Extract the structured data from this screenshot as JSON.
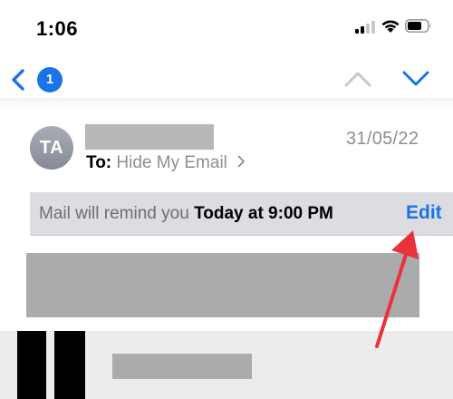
{
  "status_bar": {
    "time": "1:06",
    "icons": [
      "cellular-signal-icon",
      "wifi-icon",
      "battery-icon"
    ]
  },
  "nav": {
    "unread_count": "1",
    "icons": [
      "back-chevron-icon",
      "previous-message-chevron-icon",
      "next-message-chevron-icon"
    ]
  },
  "message": {
    "avatar_initials": "TA",
    "date": "31/05/22",
    "to_label": "To:",
    "to_value": "Hide My Email"
  },
  "reminder": {
    "text": "Mail will remind you",
    "time": "Today at 9:00 PM",
    "edit_label": "Edit"
  },
  "colors": {
    "accent": "#1a73e8",
    "banner": "#dcdde0",
    "annotation_arrow": "#e8323c",
    "secondary_text": "#8e8e93"
  }
}
